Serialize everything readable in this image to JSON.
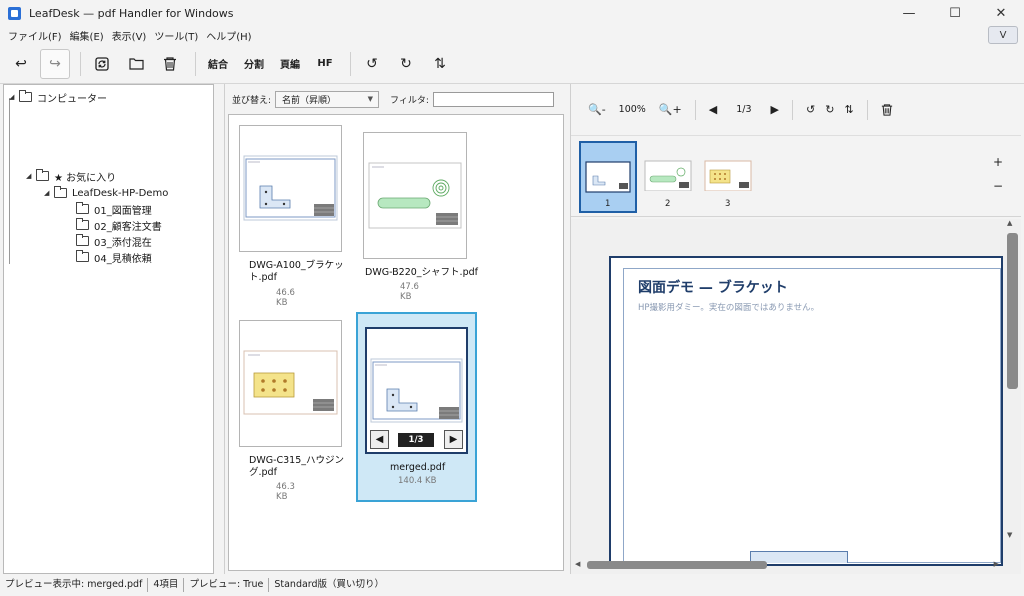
{
  "window": {
    "title": "LeafDesk — pdf Handler for Windows",
    "controls": [
      "—",
      "☐",
      "✕"
    ]
  },
  "menu": {
    "items": [
      "ファイル(F)",
      "編集(E)",
      "表示(V)",
      "ツール(T)",
      "ヘルプ(H)"
    ],
    "collapse_label": "V"
  },
  "toolbar": {
    "undo": "↩",
    "redo": "↪",
    "refresh": "⟳",
    "open_folder": "▭",
    "delete": "🗑",
    "merge_label": "結合",
    "split_label": "分割",
    "edit_label": "頁編",
    "hf_label": "HF",
    "rotate_left": "↺",
    "rotate_right": "↻",
    "swap": "⇅"
  },
  "tree": {
    "root_label": "コンピューター",
    "favorites_label": "★ お気に入り",
    "project_label": "LeafDesk-HP-Demo",
    "folders": [
      "01_図面管理",
      "02_顧客注文書",
      "03_添付混在",
      "04_見積依頼"
    ]
  },
  "list": {
    "sort_label": "並び替え:",
    "sort_value": "名前（昇順）",
    "filter_label": "フィルタ:",
    "filter_value": "",
    "files": [
      {
        "name_line1": "DWG-A100_ブラケッ",
        "name_line2": "ト.pdf",
        "size": "46.6 KB"
      },
      {
        "name_line1": "DWG-B220_シャフト.pdf",
        "name_line2": "",
        "size": "47.6 KB"
      },
      {
        "name_line1": "DWG-C315_ハウジン",
        "name_line2": "グ.pdf",
        "size": "46.3 KB"
      },
      {
        "name_line1": "merged.pdf",
        "name_line2": "",
        "size": "140.4 KB"
      }
    ],
    "selected_pager": "1/3",
    "prev": "◀",
    "next": "▶"
  },
  "preview": {
    "zoom_out": "🔍-",
    "zoom_value": "100%",
    "zoom_in": "🔍+",
    "prev": "◀",
    "page_indicator": "1/3",
    "next": "▶",
    "rotate_left": "↺",
    "rotate_right": "↻",
    "swap": "⇅",
    "delete": "🗑",
    "plus": "+",
    "minus": "−",
    "thumbs": [
      "1",
      "2",
      "3"
    ],
    "doc_title": "図面デモ — ブラケット",
    "doc_subtitle": "HP撮影用ダミー。実在の図面ではありません。"
  },
  "status": {
    "preview": "プレビュー表示中: merged.pdf",
    "count": "4項目",
    "preview_flag": "プレビュー: True",
    "edition": "Standard版（買い切り）"
  },
  "colors": {
    "accent": "#3aa3d6",
    "selected_bg": "#cfe8f6",
    "navy": "#1f3d6a"
  }
}
